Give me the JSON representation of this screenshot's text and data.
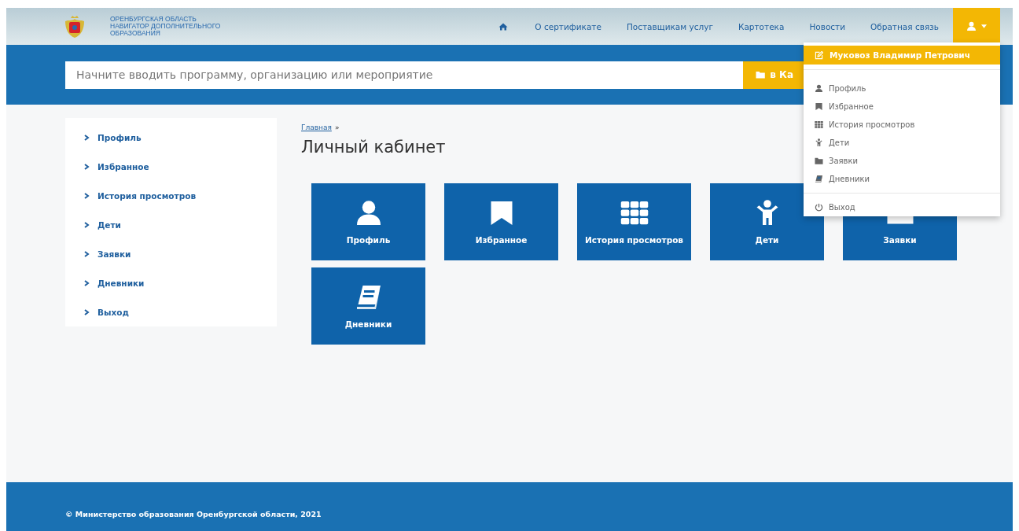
{
  "header": {
    "logo_text": [
      "ОРЕНБУРГСКАЯ ОБЛАСТЬ",
      "НАВИГАТОР ДОПОЛНИТЕЛЬНОГО",
      "ОБРАЗОВАНИЯ"
    ],
    "nav": [
      {
        "kind": "home"
      },
      {
        "kind": "link",
        "label": "О сертификате"
      },
      {
        "kind": "link",
        "label": "Поставщикам услуг"
      },
      {
        "kind": "link",
        "label": "Картотека"
      },
      {
        "kind": "link",
        "label": "Новости"
      },
      {
        "kind": "link",
        "label": "Обратная связь"
      }
    ],
    "user_menu": {
      "expanded": true,
      "user_name": "Муковоз Владимир Петрович",
      "items": [
        "Профиль",
        "Избранное",
        "История просмотров",
        "Дети",
        "Заявки",
        "Дневники"
      ],
      "logout": "Выход"
    }
  },
  "search": {
    "placeholder": "Начните вводить программу, организацию или мероприятие",
    "button": "в Ка"
  },
  "sidebar": {
    "items": [
      "Профиль",
      "Избранное",
      "История просмотров",
      "Дети",
      "Заявки",
      "Дневники",
      "Выход"
    ]
  },
  "breadcrumb": {
    "link": "Главная",
    "separator": "»"
  },
  "title": "Личный кабинет",
  "tiles": [
    "Профиль",
    "Избранное",
    "История просмотров",
    "Дети",
    "Заявки",
    "Дневники"
  ],
  "footer": "© Министерство образования Оренбургской области, 2021"
}
